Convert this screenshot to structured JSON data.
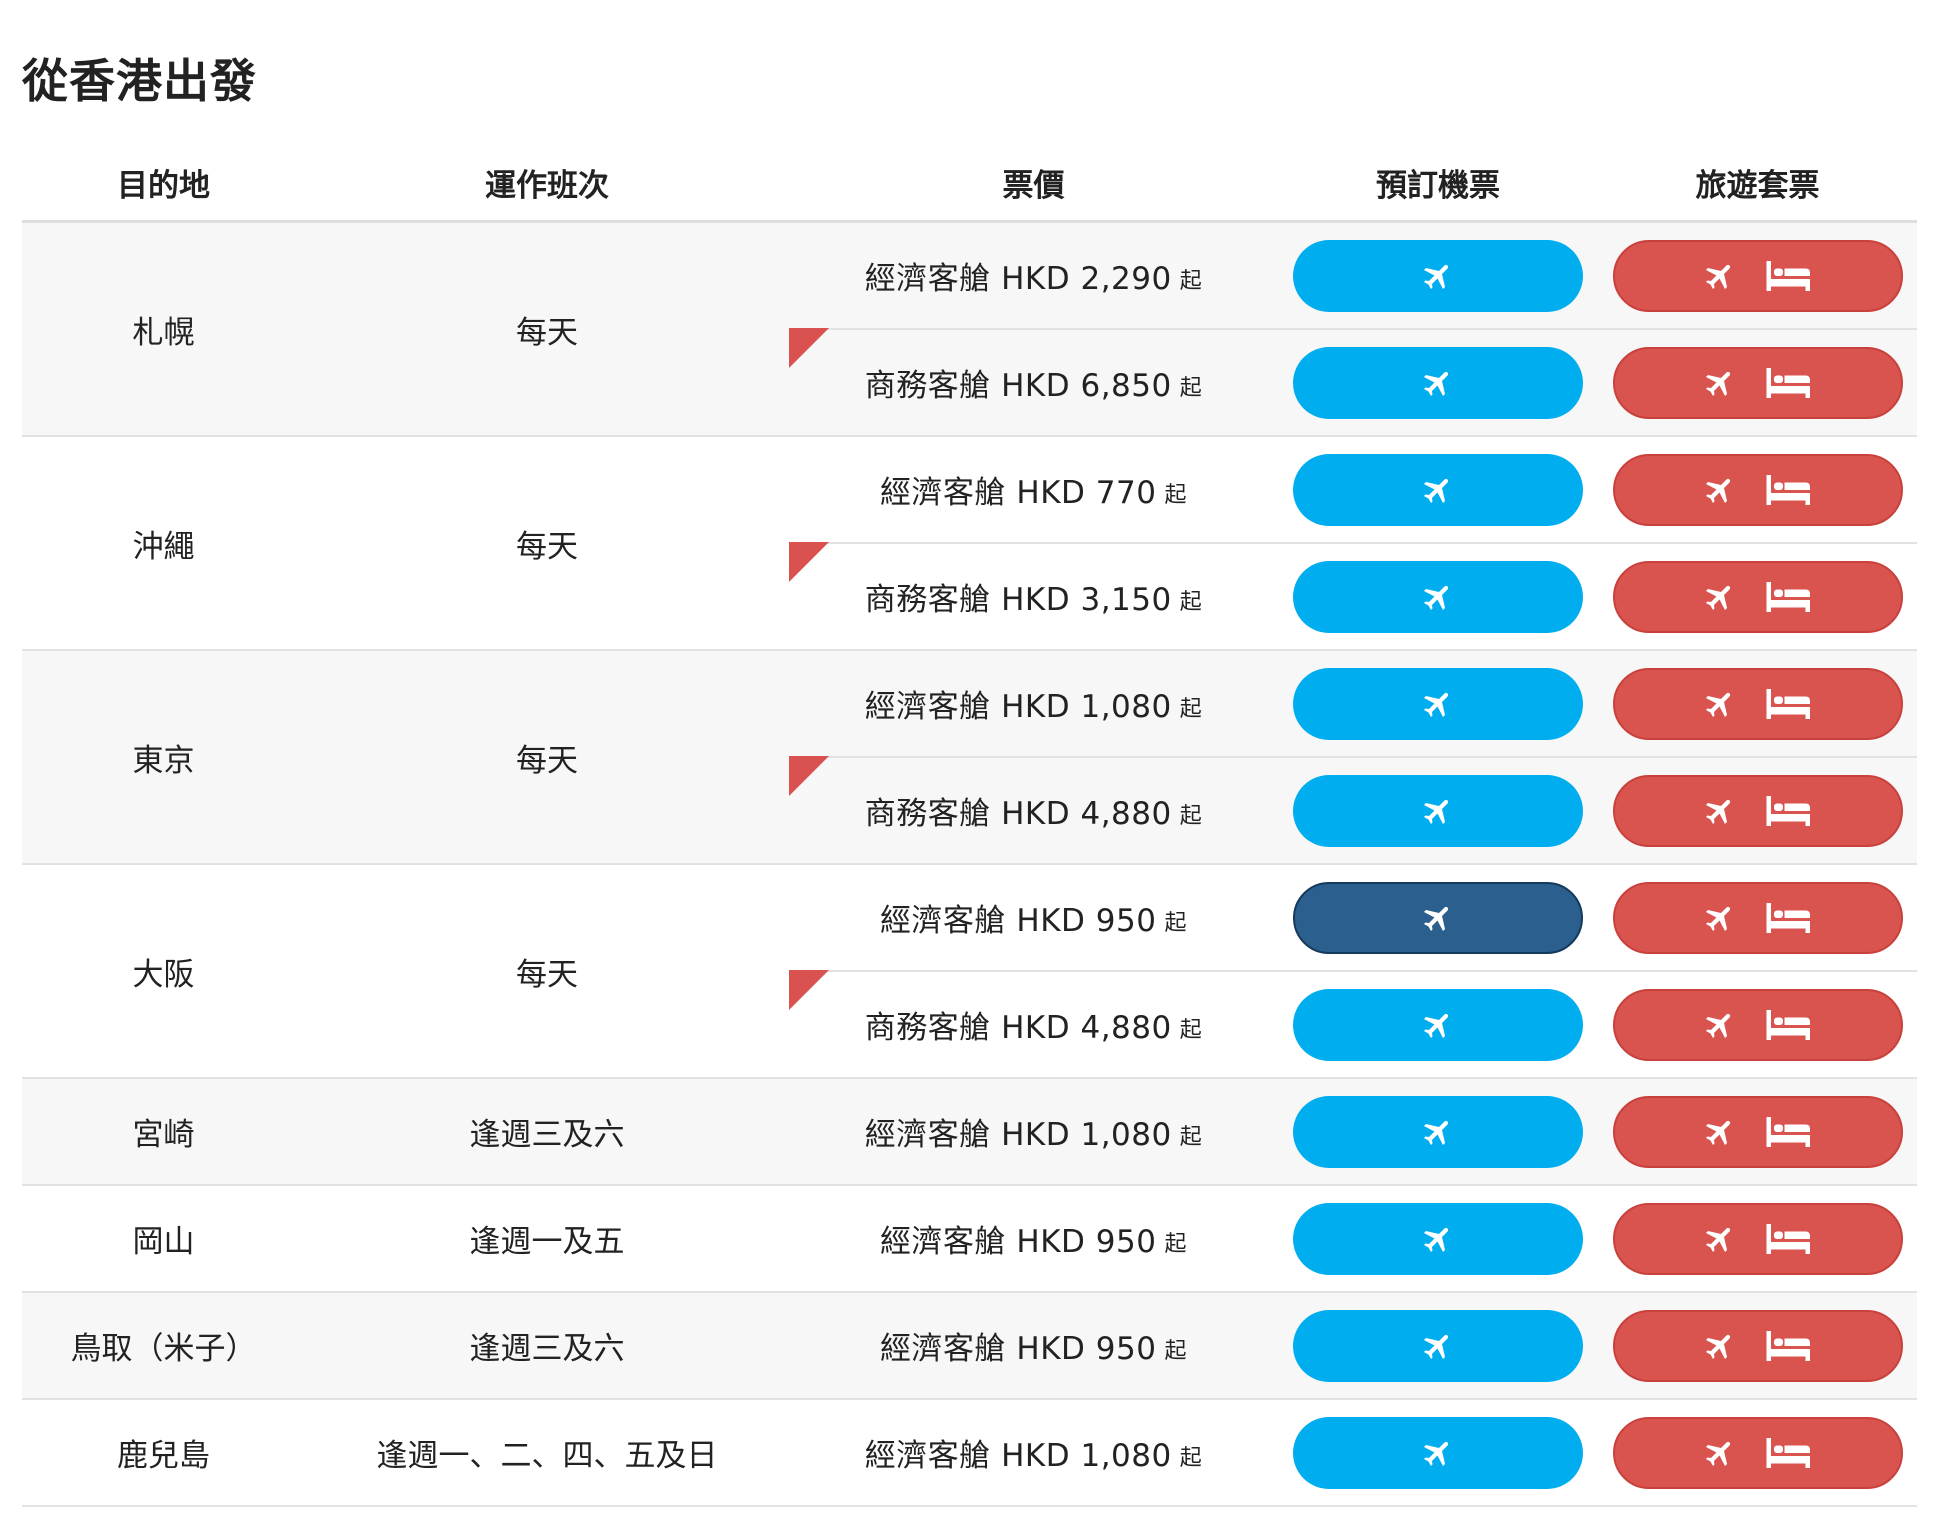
{
  "title": "從香港出發",
  "headers": {
    "destination": "目的地",
    "frequency": "運作班次",
    "fare": "票價",
    "book_flight": "預訂機票",
    "package": "旅遊套票"
  },
  "price_suffix": "起",
  "colors": {
    "flight_button": "#00aeef",
    "flight_button_active": "#2a5f8e",
    "package_button": "#d9534f",
    "flag": "#d9524f"
  },
  "icons": {
    "flight": "plane-icon",
    "hotel": "bed-icon"
  },
  "routes": [
    {
      "destination": "札幌",
      "frequency": "每天",
      "fares": [
        {
          "label": "經濟客艙 HKD 2,290"
        },
        {
          "label": "商務客艙 HKD 6,850"
        }
      ]
    },
    {
      "destination": "沖繩",
      "frequency": "每天",
      "fares": [
        {
          "label": "經濟客艙 HKD 770"
        },
        {
          "label": "商務客艙 HKD 3,150"
        }
      ]
    },
    {
      "destination": "東京",
      "frequency": "每天",
      "fares": [
        {
          "label": "經濟客艙 HKD 1,080"
        },
        {
          "label": "商務客艙 HKD 4,880"
        }
      ]
    },
    {
      "destination": "大阪",
      "frequency": "每天",
      "fares": [
        {
          "label": "經濟客艙 HKD 950",
          "active": true
        },
        {
          "label": "商務客艙 HKD 4,880"
        }
      ]
    },
    {
      "destination": "宮崎",
      "frequency": "逢週三及六",
      "fares": [
        {
          "label": "經濟客艙 HKD 1,080"
        }
      ]
    },
    {
      "destination": "岡山",
      "frequency": "逢週一及五",
      "fares": [
        {
          "label": "經濟客艙 HKD 950"
        }
      ]
    },
    {
      "destination": "鳥取（米子）",
      "frequency": "逢週三及六",
      "fares": [
        {
          "label": "經濟客艙 HKD 950"
        }
      ]
    },
    {
      "destination": "鹿兒島",
      "frequency": "逢週一、二、四、五及日",
      "fares": [
        {
          "label": "經濟客艙 HKD 1,080"
        }
      ]
    }
  ]
}
